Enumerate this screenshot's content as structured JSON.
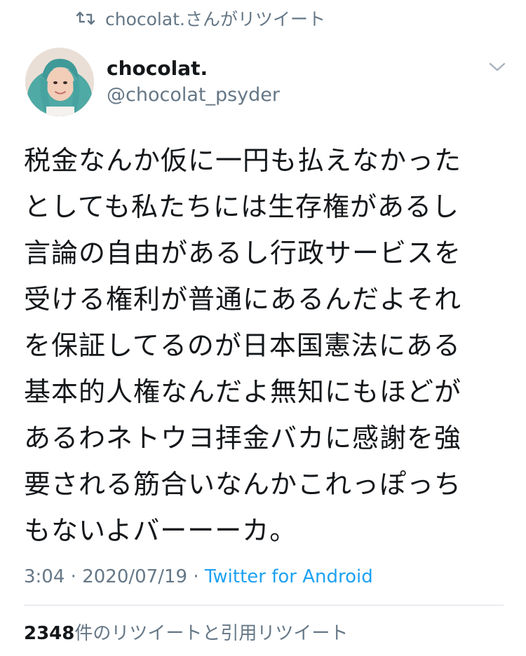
{
  "retweet_context": {
    "icon": "retweet-icon",
    "text": "chocolat.さんがリツイート"
  },
  "author": {
    "display_name": "chocolat.",
    "handle": "@chocolat_psyder",
    "avatar_icon": "avatar-photo"
  },
  "tweet": {
    "lines": [
      "税金なんか仮に一円も払えなかった",
      "としても私たちには生存権があるし",
      "言論の自由があるし行政サービスを",
      "受ける権利が普通にあるんだよそれ",
      "を保証してるのが日本国憲法にある",
      "基本的人権なんだよ無知にもほどが",
      "あるわネトウヨ拝金バカに感謝を強",
      "要される筋合いなんかこれっぽっち",
      "もないよバーーーカ。"
    ]
  },
  "meta": {
    "time": "3:04",
    "separator": " · ",
    "date": "2020/07/19",
    "source": "Twitter for Android"
  },
  "stats": {
    "retweet_count": "2348",
    "retweet_label": "件のリツイートと引用リツイート"
  },
  "colors": {
    "secondary_text": "#657786",
    "link": "#1da1f2",
    "primary_text": "#14171a",
    "divider": "#d6dde3"
  }
}
